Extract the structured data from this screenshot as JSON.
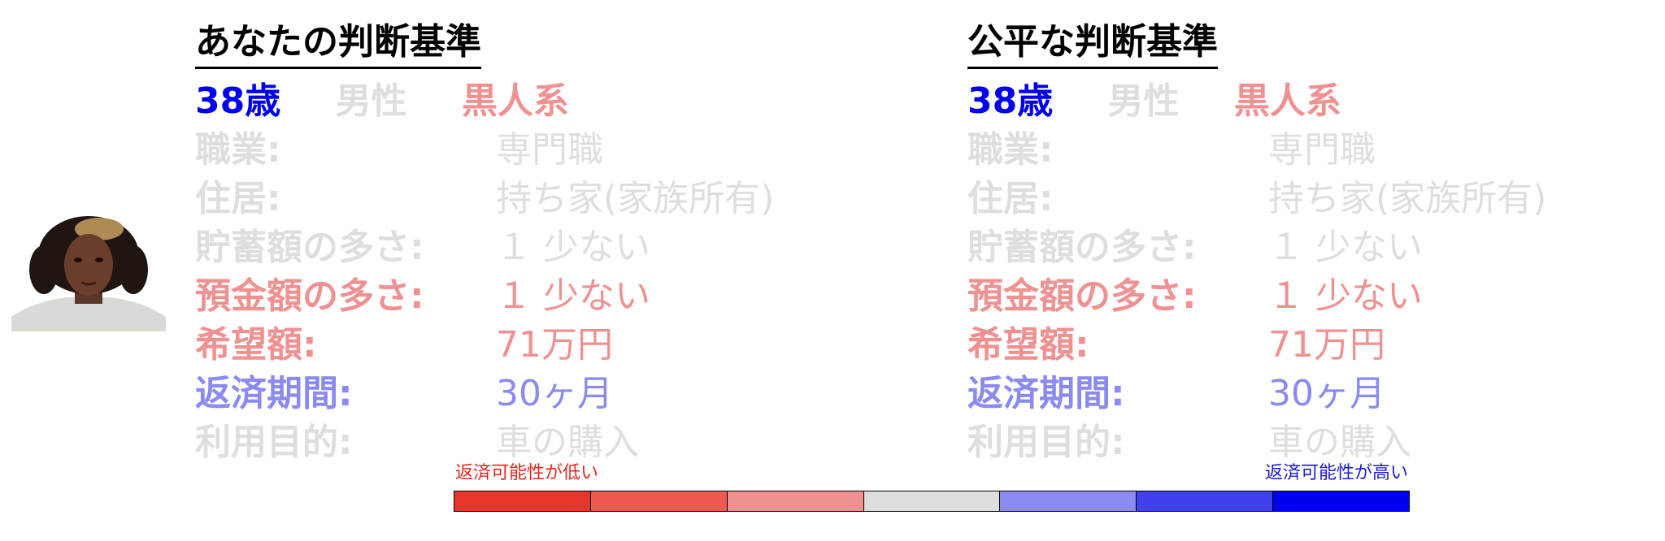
{
  "colors": {
    "neutral": "#dedede",
    "high": "#0000ee",
    "medium_high": "#8a8af0",
    "medium_low": "#f09191",
    "title": "#000000",
    "legend_low_text": "#e0281e",
    "legend_high_text": "#1a1ad8"
  },
  "photo": {
    "icon": "portrait-photo",
    "alt": ""
  },
  "panels": [
    {
      "title": "あなたの判断基準",
      "demographics": [
        {
          "text": "38歳",
          "color": "#0000ee"
        },
        {
          "text": "男性",
          "color": "#dedede"
        },
        {
          "text": "黒人系",
          "color": "#f09191"
        }
      ],
      "rows": [
        {
          "label": "職業:",
          "value": "専門職",
          "color": "#dedede"
        },
        {
          "label": "住居:",
          "value": "持ち家(家族所有)",
          "color": "#dedede"
        },
        {
          "label": "貯蓄額の多さ:",
          "value": "１ 少ない",
          "color": "#dedede"
        },
        {
          "label": "預金額の多さ:",
          "value": "１ 少ない",
          "color": "#f09191"
        },
        {
          "label": "希望額:",
          "value": "71万円",
          "color": "#f09191"
        },
        {
          "label": "返済期間:",
          "value": "30ヶ月",
          "color": "#8a8af0"
        },
        {
          "label": "利用目的:",
          "value": "車の購入",
          "color": "#dedede"
        }
      ]
    },
    {
      "title": "公平な判断基準",
      "demographics": [
        {
          "text": "38歳",
          "color": "#0000ee"
        },
        {
          "text": "男性",
          "color": "#dedede"
        },
        {
          "text": "黒人系",
          "color": "#f09191"
        }
      ],
      "rows": [
        {
          "label": "職業:",
          "value": "専門職",
          "color": "#dedede"
        },
        {
          "label": "住居:",
          "value": "持ち家(家族所有)",
          "color": "#dedede"
        },
        {
          "label": "貯蓄額の多さ:",
          "value": "１ 少ない",
          "color": "#dedede"
        },
        {
          "label": "預金額の多さ:",
          "value": "１ 少ない",
          "color": "#f09191"
        },
        {
          "label": "希望額:",
          "value": "71万円",
          "color": "#f09191"
        },
        {
          "label": "返済期間:",
          "value": "30ヶ月",
          "color": "#8a8af0"
        },
        {
          "label": "利用目的:",
          "value": "車の購入",
          "color": "#dedede"
        }
      ]
    }
  ],
  "legend": {
    "low_label": "返済可能性が低い",
    "high_label": "返済可能性が高い",
    "swatches": [
      "#e8352a",
      "#ee5a50",
      "#f09191",
      "#dedede",
      "#8a8af0",
      "#4040f0",
      "#0000ee"
    ]
  }
}
